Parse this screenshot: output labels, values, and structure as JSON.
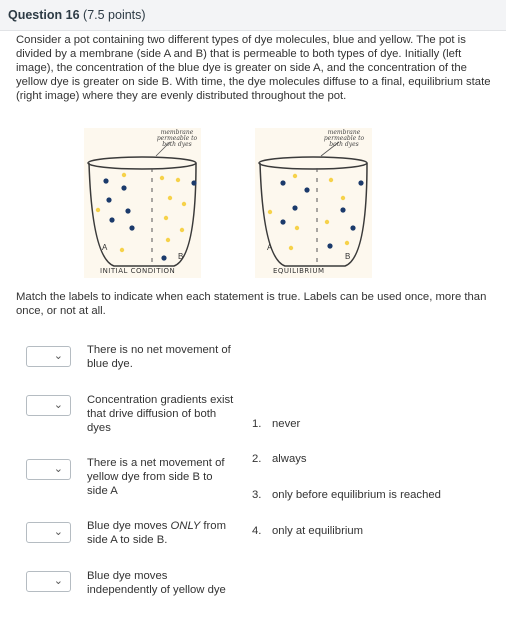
{
  "question": {
    "title": "Question 16",
    "points": "(7.5 points)",
    "intro": "Consider a pot containing two different types of dye molecules, blue and yellow. The pot is divided by a membrane (side A and B) that is permeable to both types of dye. Initially (left image), the concentration of the blue dye is greater on side A, and the concentration of the yellow dye is greater on side B. With time, the dye molecules diffuse to a final, equilibrium state (right image) where they are evenly distributed throughout the pot.",
    "instructions": "Match the labels to indicate when each statement is true. Labels can be used once, more than once, or not at all."
  },
  "figures": {
    "left": {
      "caption": "INITIAL CONDITION",
      "annotation": "membrane permeable to both dyes",
      "side_a": "A",
      "side_b": "B"
    },
    "right": {
      "caption": "EQUILIBRIUM",
      "annotation": "membrane permeable to both dyes",
      "side_a": "A",
      "side_b": "B"
    },
    "colors": {
      "blue": "#1b3a6b",
      "yellow": "#f6d24a",
      "pot": "#3a3a3a",
      "membrane": "#555555"
    }
  },
  "statements": [
    {
      "text": "There is no net movement of blue dye.",
      "selected": ""
    },
    {
      "text": "Concentration gradients exist that drive diffusion of both dyes",
      "selected": ""
    },
    {
      "text": "There is a net movement of yellow dye from side B to side A",
      "selected": ""
    },
    {
      "text_pre": "Blue dye moves ",
      "text_em": "ONLY",
      "text_post": " from side A to side B.",
      "selected": ""
    },
    {
      "text": "Blue dye moves independently of yellow dye",
      "selected": ""
    }
  ],
  "answers": [
    {
      "num": "1.",
      "label": "never"
    },
    {
      "num": "2.",
      "label": "always"
    },
    {
      "num": "3.",
      "label": "only before equilibrium is reached"
    },
    {
      "num": "4.",
      "label": "only at equilibrium"
    }
  ]
}
